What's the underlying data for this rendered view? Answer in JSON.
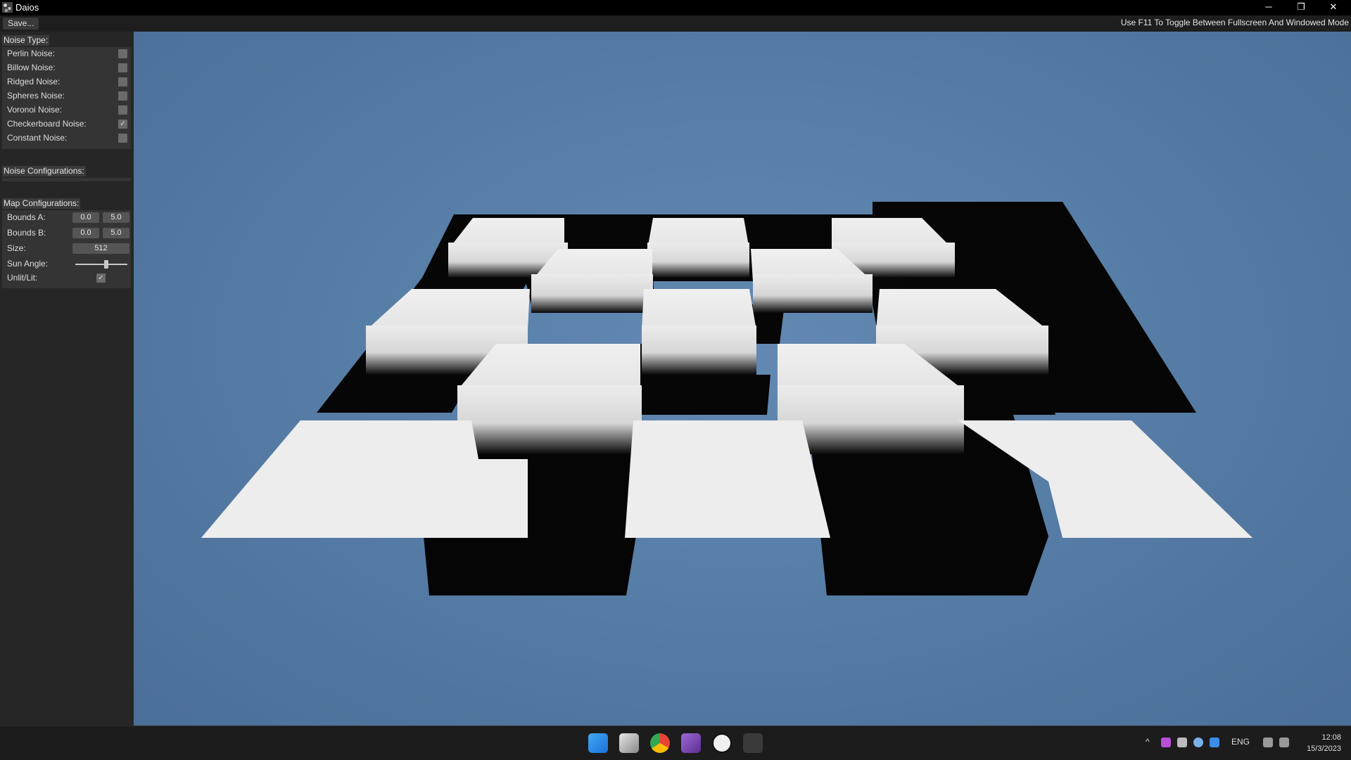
{
  "window": {
    "title": "Daios",
    "controls": {
      "minimize": "─",
      "restore": "❐",
      "close": "✕"
    }
  },
  "menubar": {
    "save_label": "Save...",
    "hint": "Use F11 To Toggle Between Fullscreen And Windowed Mode"
  },
  "noise_type": {
    "title": "Noise Type:",
    "items": [
      {
        "label": "Perlin Noise:",
        "checked": false
      },
      {
        "label": "Billow Noise:",
        "checked": false
      },
      {
        "label": "Ridged Noise:",
        "checked": false
      },
      {
        "label": "Spheres Noise:",
        "checked": false
      },
      {
        "label": "Voronoi Noise:",
        "checked": false
      },
      {
        "label": "Checkerboard Noise:",
        "checked": true
      },
      {
        "label": "Constant Noise:",
        "checked": false
      }
    ]
  },
  "noise_config": {
    "title": "Noise Configurations:"
  },
  "map_config": {
    "title": "Map Configurations:",
    "bounds_a": {
      "label": "Bounds A:",
      "min": "0.0",
      "max": "5.0"
    },
    "bounds_b": {
      "label": "Bounds B:",
      "min": "0.0",
      "max": "5.0"
    },
    "size": {
      "label": "Size:",
      "value": "512"
    },
    "sun_angle": {
      "label": "Sun Angle:",
      "level": 0.6
    },
    "unlit": {
      "label": "Unlit/Lit:",
      "checked": true
    }
  },
  "checkmark": "✓",
  "taskbar": {
    "apps": [
      "windows-start",
      "task-view",
      "chrome",
      "visual-studio",
      "unreal-engine",
      "daios"
    ],
    "tray": {
      "chevron": "^",
      "language": "ENG",
      "time": "12:08",
      "date": "15/3/2023"
    }
  },
  "colors": {
    "sky": "#5a82ad",
    "panel": "#343434",
    "sidebar": "#262626",
    "taskbar": "#1c1c1c"
  }
}
